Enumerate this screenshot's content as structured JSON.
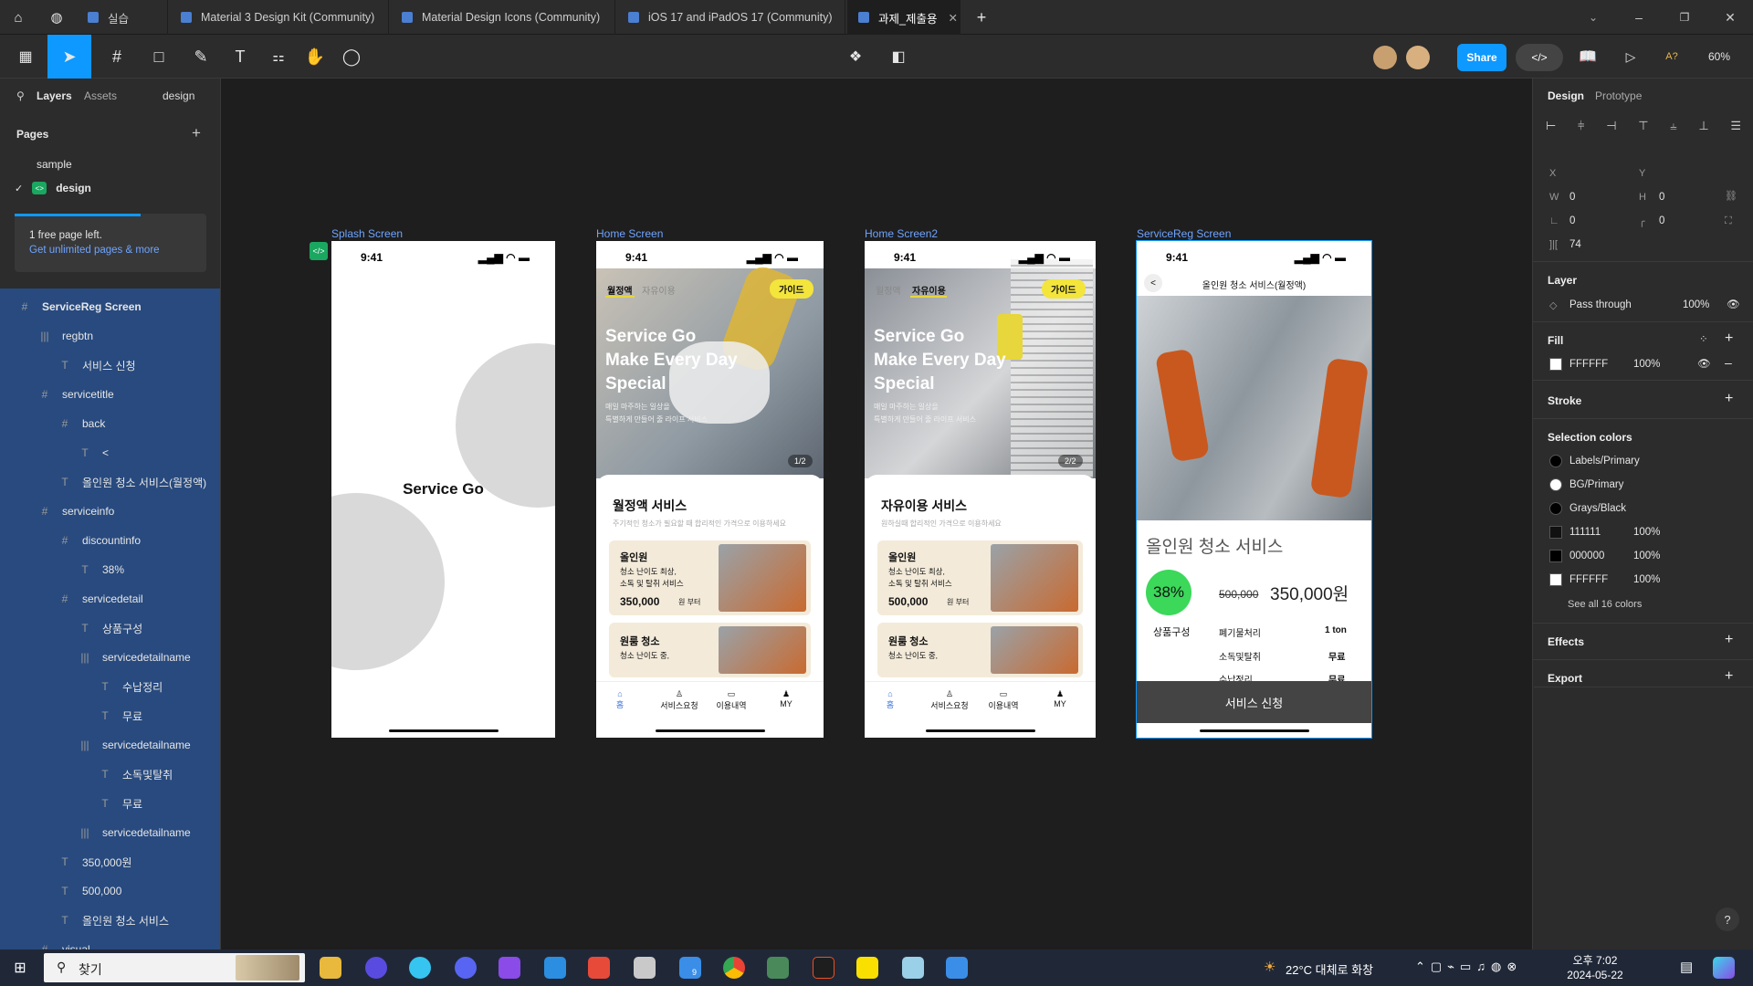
{
  "tabs": [
    {
      "label": "실습"
    },
    {
      "label": "Material 3 Design Kit (Community)"
    },
    {
      "label": "Material Design Icons (Community)"
    },
    {
      "label": "iOS 17 and iPadOS 17 (Community)"
    },
    {
      "label": "과제_제출용"
    }
  ],
  "toolbar": {
    "share_label": "Share",
    "zoom": "60%",
    "ai_label": "A?"
  },
  "left_panel": {
    "tab_layers": "Layers",
    "tab_assets": "Assets",
    "page_switch": "design",
    "pages_title": "Pages",
    "pages": [
      "sample",
      "design"
    ],
    "upgrade_title": "1 free page left.",
    "upgrade_link": "Get unlimited pages & more",
    "layers": [
      {
        "name": "ServiceReg Screen",
        "type": "frame",
        "indent": 0
      },
      {
        "name": "regbtn",
        "type": "hstack",
        "indent": 1
      },
      {
        "name": "서비스 신청",
        "type": "text",
        "indent": 2
      },
      {
        "name": "servicetitle",
        "type": "frame",
        "indent": 1
      },
      {
        "name": "back",
        "type": "frame",
        "indent": 2
      },
      {
        "name": "<",
        "type": "text",
        "indent": 3
      },
      {
        "name": "올인원 청소 서비스(월정액)",
        "type": "text",
        "indent": 2
      },
      {
        "name": "serviceinfo",
        "type": "frame",
        "indent": 1
      },
      {
        "name": "discountinfo",
        "type": "frame",
        "indent": 2
      },
      {
        "name": "38%",
        "type": "text",
        "indent": 3
      },
      {
        "name": "servicedetail",
        "type": "frame",
        "indent": 2
      },
      {
        "name": "상품구성",
        "type": "text",
        "indent": 3
      },
      {
        "name": "servicedetailname",
        "type": "hstack",
        "indent": 3
      },
      {
        "name": "수납정리",
        "type": "text",
        "indent": 4
      },
      {
        "name": "무료",
        "type": "text",
        "indent": 4
      },
      {
        "name": "servicedetailname",
        "type": "hstack",
        "indent": 3
      },
      {
        "name": "소독및탈취",
        "type": "text",
        "indent": 4
      },
      {
        "name": "무료",
        "type": "text",
        "indent": 4
      },
      {
        "name": "servicedetailname",
        "type": "hstack",
        "indent": 3
      },
      {
        "name": "350,000원",
        "type": "text",
        "indent": 2
      },
      {
        "name": "500,000",
        "type": "text",
        "indent": 2
      },
      {
        "name": "올인원 청소 서비스",
        "type": "text",
        "indent": 2
      },
      {
        "name": "visual",
        "type": "frame",
        "indent": 1
      }
    ]
  },
  "right_panel": {
    "tab_design": "Design",
    "tab_prototype": "Prototype",
    "x_label": "X",
    "y_label": "Y",
    "w_label": "W",
    "w_value": "0",
    "h_label": "H",
    "h_value": "0",
    "rot_value": "0",
    "radius_value": "0",
    "spacing_value": "74",
    "layer_title": "Layer",
    "blend": "Pass through",
    "layer_opacity": "100%",
    "fill_title": "Fill",
    "fill_hex": "FFFFFF",
    "fill_opacity": "100%",
    "stroke_title": "Stroke",
    "selection_colors_title": "Selection colors",
    "selection_colors": [
      {
        "name": "Labels/Primary",
        "color": "#000000",
        "opacity": ""
      },
      {
        "name": "BG/Primary",
        "color": "#ffffff",
        "opacity": ""
      },
      {
        "name": "Grays/Black",
        "color": "#000000",
        "opacity": ""
      },
      {
        "name": "111111",
        "color": "#111111",
        "opacity": "100%"
      },
      {
        "name": "000000",
        "color": "#000000",
        "opacity": "100%"
      },
      {
        "name": "FFFFFF",
        "color": "#ffffff",
        "opacity": "100%"
      }
    ],
    "see_all": "See all 16 colors",
    "effects_title": "Effects",
    "export_title": "Export",
    "help": "?"
  },
  "canvas": {
    "splash": {
      "label": "Splash Screen",
      "time": "9:41",
      "title": "Service Go"
    },
    "home": {
      "label": "Home Screen",
      "time": "9:41",
      "tab1": "월정액",
      "tab2": "자유이용",
      "guide": "가이드",
      "hero_title": "Service Go Make Every Day Special",
      "hero_sub1": "매일 마주하는 일상을",
      "hero_sub2": "특별하게 만들어 줄 라이프 서비스",
      "pager": "1/2",
      "section": "월정액 서비스",
      "section_sub": "주기적인 청소가 필요할 때 합리적인 가격으로 이용하세요",
      "card1_title": "올인원",
      "card1_l1": "청소 난이도 최상,",
      "card1_l2": "소독 및 탈취 서비스",
      "card1_price": "350,000",
      "card1_unit": "원 부터",
      "card2_title": "원룸 청소",
      "card2_l1": "청소 난이도 중,",
      "nav": [
        "홈",
        "서비스요청",
        "이용내역",
        "MY"
      ]
    },
    "home2": {
      "label": "Home Screen2",
      "time": "9:41",
      "tab1": "월정액",
      "tab2": "자유이용",
      "guide": "가이드",
      "hero_title": "Service Go Make Every Day Special",
      "hero_sub1": "매일 마주하는 일상을",
      "hero_sub2": "특별하게 만들어 줄 라이프 서비스",
      "pager": "2/2",
      "section": "자유이용 서비스",
      "section_sub": "원하실때 합리적인 가격으로 이용하세요",
      "card1_title": "올인원",
      "card1_l1": "청소 난이도 최상,",
      "card1_l2": "소독 및 탈취 서비스",
      "card1_price": "500,000",
      "card1_unit": "원 부터",
      "card2_title": "원룸 청소",
      "card2_l1": "청소 난이도 중,",
      "nav": [
        "홈",
        "서비스요청",
        "이용내역",
        "MY"
      ]
    },
    "servicereg": {
      "label": "ServiceReg Screen",
      "time": "9:41",
      "back": "<",
      "header": "올인원 청소 서비스(월정액)",
      "title": "올인원 청소 서비스",
      "discount": "38%",
      "old_price": "500,000",
      "price": "350,000원",
      "detail_label": "상품구성",
      "details": [
        {
          "name": "폐기물처리",
          "value": "1 ton"
        },
        {
          "name": "소독및탈취",
          "value": "무료"
        },
        {
          "name": "수납정리",
          "value": "무료"
        }
      ],
      "button": "서비스 신청"
    }
  },
  "taskbar": {
    "search": "찾기",
    "weather": "22°C 대체로 화창",
    "time": "오후 7:02",
    "date": "2024-05-22",
    "badge": "9"
  }
}
